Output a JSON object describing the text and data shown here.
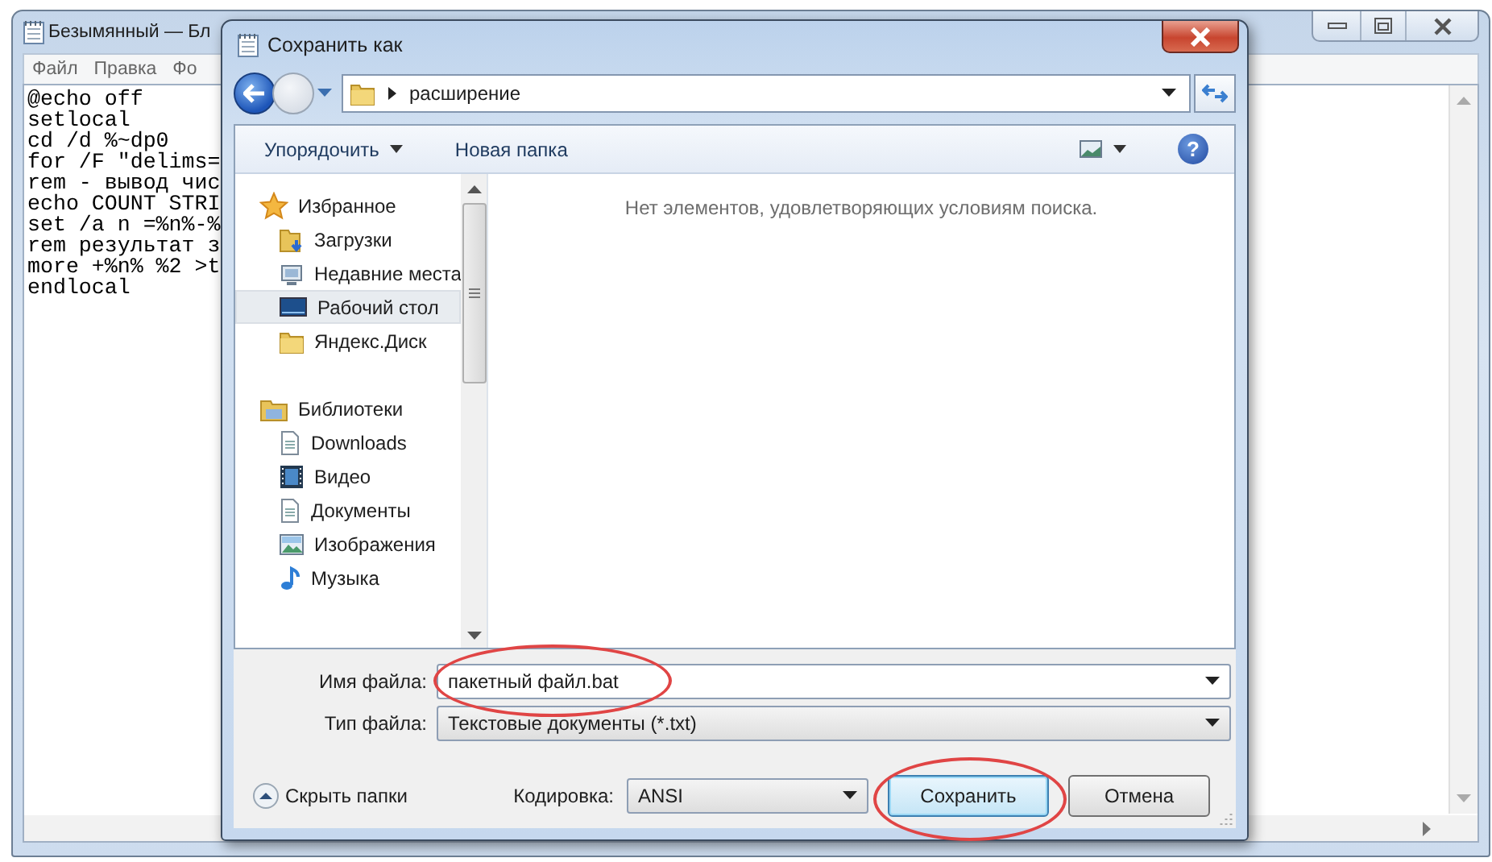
{
  "notepad": {
    "title": "Безымянный — Бл",
    "menu": [
      "Файл",
      "Правка",
      "Фо"
    ],
    "lines": [
      "@echo off",
      "setlocal",
      "cd /d %~dp0",
      "for /F \"delims=",
      "rem - вывод чис",
      "echo COUNT STRI",
      "set /a n =%n%-%",
      "rem результат з",
      "more +%n% %2 >t",
      "endlocal"
    ]
  },
  "dialog": {
    "title": "Сохранить как",
    "path": [
      "расширение"
    ],
    "toolbar": {
      "organize": "Упорядочить",
      "new_folder": "Новая папка",
      "help": "?"
    },
    "nav": [
      {
        "label": "Избранное",
        "selected": false,
        "children": [
          {
            "label": "Загрузки",
            "selected": false
          },
          {
            "label": "Недавние места",
            "selected": false
          },
          {
            "label": "Рабочий стол",
            "selected": true
          },
          {
            "label": "Яндекс.Диск",
            "selected": false
          }
        ]
      },
      {
        "label": "Библиотеки",
        "selected": false,
        "children": [
          {
            "label": "Downloads",
            "selected": false
          },
          {
            "label": "Видео",
            "selected": false
          },
          {
            "label": "Документы",
            "selected": false
          },
          {
            "label": "Изображения",
            "selected": false
          },
          {
            "label": "Музыка",
            "selected": false
          }
        ]
      }
    ],
    "empty_message": "Нет элементов, удовлетворяющих условиям поиска.",
    "file_name": {
      "label": "Имя файла:",
      "value": "пакетный файл.bat",
      "highlighted": true
    },
    "file_type": {
      "label": "Тип файла:",
      "value": "Текстовые документы (*.txt)"
    },
    "hide_folders": "Скрыть папки",
    "encoding": {
      "label": "Кодировка:",
      "value": "ANSI"
    },
    "buttons": [
      {
        "label": "Сохранить",
        "default": true,
        "highlighted": true
      },
      {
        "label": "Отмена",
        "default": false,
        "highlighted": false
      }
    ]
  }
}
